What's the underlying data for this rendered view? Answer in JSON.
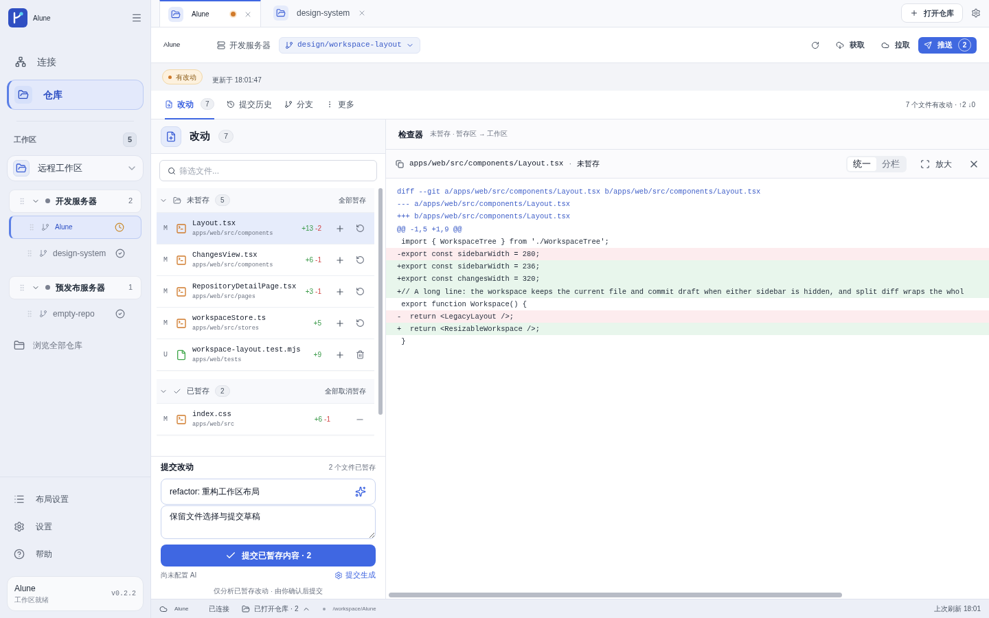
{
  "sidebar": {
    "app_name": "Alune",
    "nav": [
      {
        "label": "连接",
        "kind": "network",
        "selected": false
      },
      {
        "label": "仓库",
        "kind": "folder",
        "selected": true
      }
    ],
    "workspace": {
      "title": "工作区",
      "count": "5",
      "dropdown": "远程工作区",
      "groups": [
        {
          "name": "开发服务器",
          "count": "2",
          "expanded": true,
          "repos": [
            {
              "name": "Alune",
              "selected": true,
              "synced": false
            },
            {
              "name": "design-system",
              "selected": false,
              "synced": true
            }
          ]
        },
        {
          "name": "预发布服务器",
          "count": "1",
          "expanded": true,
          "repos": [
            {
              "name": "empty-repo",
              "selected": false,
              "synced": true
            }
          ]
        }
      ]
    },
    "browse": "浏览全部仓库",
    "bottom": [
      {
        "label": "布局设置",
        "kind": "layout"
      },
      {
        "label": "设置",
        "kind": "settings"
      },
      {
        "label": "帮助",
        "kind": "help"
      }
    ],
    "footer": {
      "name": "Alune",
      "status": "工作区就绪",
      "version": "v0.2.2"
    }
  },
  "tabs": [
    {
      "label": "Alune",
      "selected": true,
      "modified": true
    },
    {
      "label": "design-system",
      "selected": false,
      "modified": false
    }
  ],
  "open_repo": "打开仓库",
  "toolbar": {
    "repo": "Alune",
    "server": "开发服务器",
    "branch": "design/workspace-layout",
    "fetch": "获取",
    "pull": "拉取",
    "push": "推送",
    "push_count": "2"
  },
  "status": {
    "badge": "有改动",
    "updated": "更新于 18:01:47"
  },
  "view_tabs": [
    {
      "label": "改动",
      "kind": "changes",
      "count": "7",
      "selected": true
    },
    {
      "label": "提交历史",
      "kind": "history",
      "selected": false
    },
    {
      "label": "分支",
      "kind": "branch",
      "selected": false
    },
    {
      "label": "更多",
      "kind": "more",
      "selected": false
    }
  ],
  "summary": "7 个文件有改动 · ↑2 ↓0",
  "changes": {
    "title": "改动",
    "count": "7",
    "filter_placeholder": "筛选文件...",
    "sections": [
      {
        "title": "未暂存",
        "kind": "unstaged",
        "count": "5",
        "action": "全部暂存",
        "files": [
          {
            "status": "M",
            "kind": "code",
            "name": "Layout.tsx",
            "path": "apps/web/src/components",
            "added": "+13",
            "removed": "-2",
            "selected": true
          },
          {
            "status": "M",
            "kind": "code",
            "name": "ChangesView.tsx",
            "path": "apps/web/src/components",
            "added": "+6",
            "removed": "-1",
            "selected": false
          },
          {
            "status": "M",
            "kind": "code",
            "name": "RepositoryDetailPage.tsx",
            "path": "apps/web/src/pages",
            "added": "+3",
            "removed": "-1",
            "selected": false
          },
          {
            "status": "M",
            "kind": "code",
            "name": "workspaceStore.ts",
            "path": "apps/web/src/stores",
            "added": "+5",
            "selected": false
          },
          {
            "status": "U",
            "kind": "new",
            "name": "workspace-layout.test.mjs",
            "path": "apps/web/tests",
            "added": "+9",
            "selected": false
          }
        ]
      },
      {
        "title": "已暂存",
        "kind": "staged",
        "count": "2",
        "action": "全部取消暂存",
        "files": [
          {
            "status": "M",
            "kind": "code",
            "name": "index.css",
            "path": "apps/web/src",
            "added": "+6",
            "removed": "-1",
            "selected": false
          }
        ]
      }
    ]
  },
  "commit": {
    "title": "提交改动",
    "staged": "2 个文件已暂存",
    "summary": "refactor: 重构工作区布局",
    "description": "保留文件选择与提交草稿",
    "button": "提交已暂存内容 · 2",
    "ai_note": "尚未配置 AI",
    "ai_link": "提交生成",
    "footnote": "仅分析已暂存改动 · 由你确认后提交"
  },
  "inspector": {
    "title": "检查器",
    "subtitle": "未暂存 · 暂存区 → 工作区",
    "file": "apps/web/src/components/Layout.tsx",
    "separator": "·",
    "file_state": "未暂存",
    "views": [
      {
        "label": "统一",
        "selected": true
      },
      {
        "label": "分栏",
        "selected": false
      }
    ],
    "zoom": "放大",
    "diff": [
      {
        "kind": "meta",
        "text": "diff --git a/apps/web/src/components/Layout.tsx b/apps/web/src/components/Layout.tsx"
      },
      {
        "kind": "meta",
        "text": "--- a/apps/web/src/components/Layout.tsx"
      },
      {
        "kind": "meta",
        "text": "+++ b/apps/web/src/components/Layout.tsx"
      },
      {
        "kind": "meta",
        "text": "@@ -1,5 +1,9 @@"
      },
      {
        "kind": "context",
        "text": " import { WorkspaceTree } from './WorkspaceTree';"
      },
      {
        "kind": "del",
        "text": "-export const sidebarWidth = 280;"
      },
      {
        "kind": "add",
        "text": "+export const sidebarWidth = 236;"
      },
      {
        "kind": "add",
        "text": "+export const changesWidth = 320;"
      },
      {
        "kind": "add",
        "text": "+// A long line: the workspace keeps the current file and commit draft when either sidebar is hidden, and split diff wraps the whol"
      },
      {
        "kind": "context",
        "text": " export function Workspace() {"
      },
      {
        "kind": "del",
        "text": "-  return <LegacyLayout />;"
      },
      {
        "kind": "add",
        "text": "+  return <ResizableWorkspace />;"
      },
      {
        "kind": "context",
        "text": " }"
      }
    ]
  },
  "status_bar": {
    "host": "Alune",
    "connection": "已连接",
    "open_repos": "已打开仓库 · 2",
    "path": "/workspace/Alune",
    "refreshed": "上次刷新 18:01"
  }
}
